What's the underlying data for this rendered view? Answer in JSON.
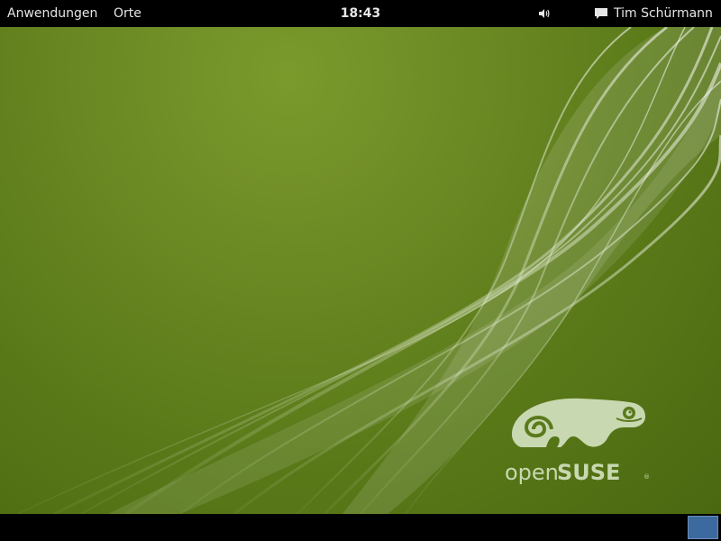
{
  "top_panel": {
    "applications_label": "Anwendungen",
    "places_label": "Orte",
    "clock": "18:43",
    "user_name": "Tim Schürmann",
    "icons": [
      "volume-icon",
      "chat-icon"
    ]
  },
  "desktop": {
    "wallpaper_colors": {
      "base": "#5a7a1c",
      "highlight": "#7a9a2c",
      "wave": "#e8f0d8"
    },
    "logo": {
      "text_open": "open",
      "text_suse": "SUSE",
      "registered": "®",
      "color": "#c8d8b0"
    }
  },
  "bottom_panel": {
    "workspace_color": "#3d6a9e"
  }
}
